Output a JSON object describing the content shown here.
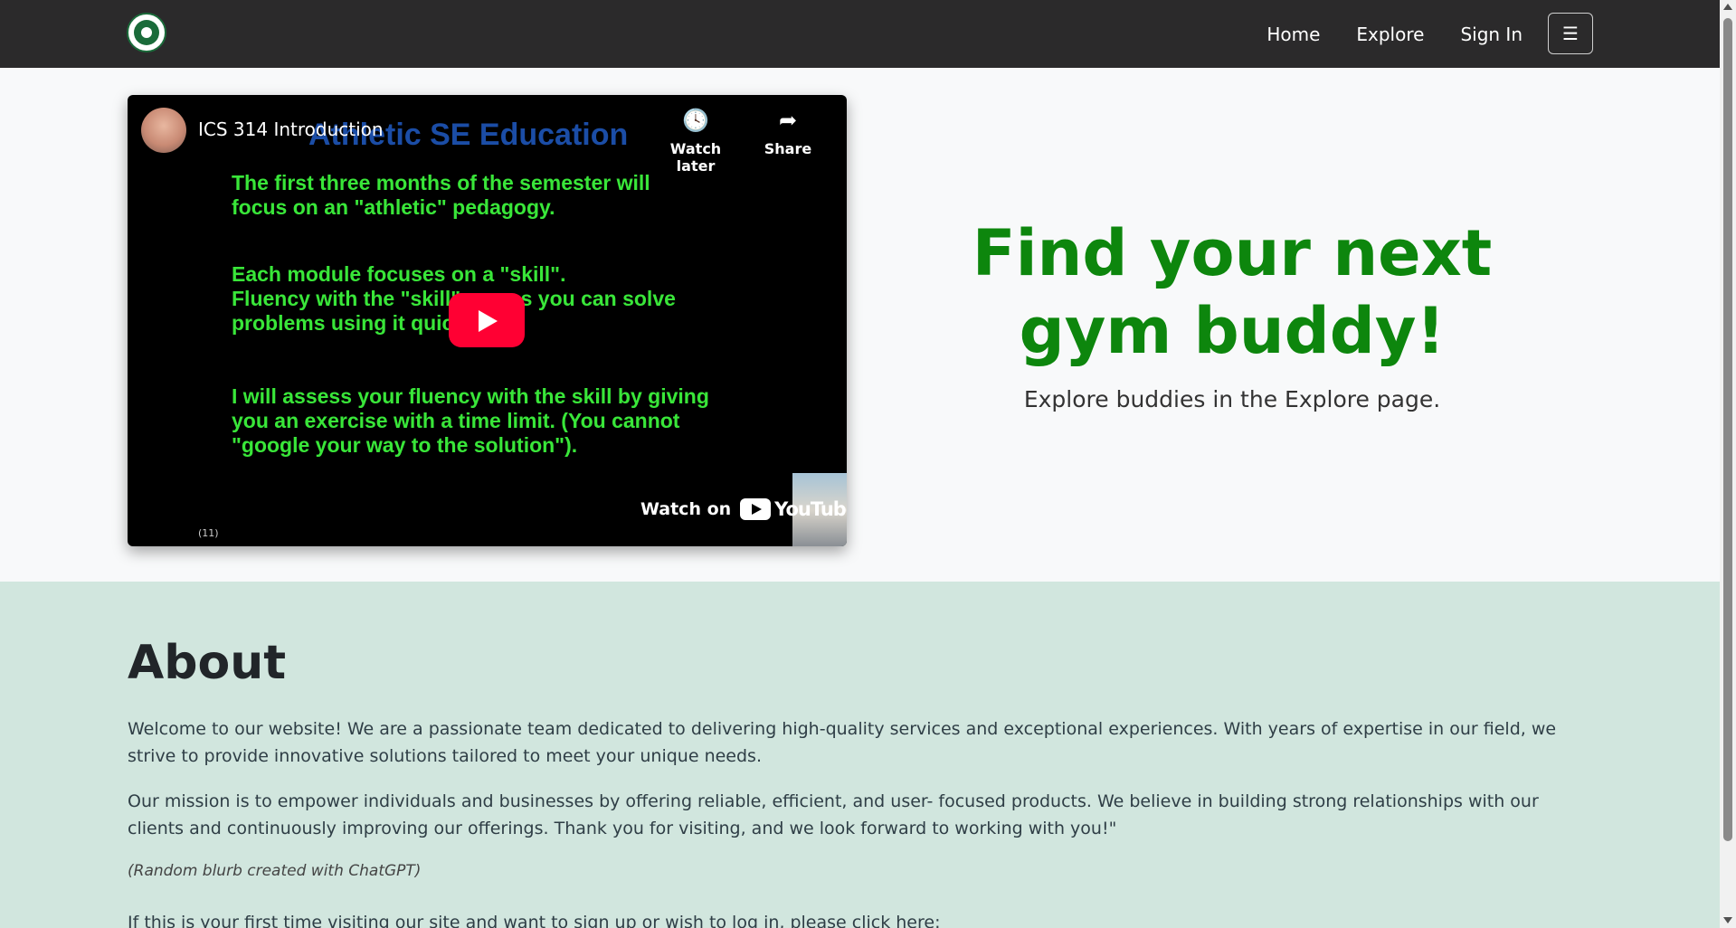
{
  "navbar": {
    "links": [
      "Home",
      "Explore",
      "Sign In"
    ],
    "menu_icon": "☰"
  },
  "video": {
    "title": "ICS 314 Introduction",
    "slide_heading": "Athletic SE Education",
    "slide_paragraphs": [
      "The first three months of the semester will\nfocus on an \"athletic\" pedagogy.",
      "Each module focuses on a \"skill\".\nFluency with the \"skill\" means you can solve\nproblems using it quickly.",
      "I will assess your fluency with the skill by giving\nyou an exercise with a time limit.  (You cannot\n\"google your way to the solution\")."
    ],
    "watch_later_label": "Watch later",
    "share_label": "Share",
    "watch_on_label": "Watch on",
    "youtube_label": "YouTube",
    "slide_counter": "(11)"
  },
  "hero": {
    "heading": "Find your next gym buddy!",
    "subheading": "Explore buddies in the Explore page."
  },
  "about": {
    "title": "About",
    "paragraph1": "Welcome to our website! We are a passionate team dedicated to delivering high-quality services and exceptional experiences. With years of expertise in our field, we strive to provide innovative solutions tailored to meet your unique needs.",
    "paragraph2": "Our mission is to empower individuals and businesses by offering reliable, efficient, and user- focused products. We believe in building strong relationships with our clients and continuously improving our offerings. Thank you for visiting, and we look forward to working with you!\"",
    "note": "(Random blurb created with ChatGPT)",
    "cta": "If this is your first time visiting our site and want to sign up or wish to log in, please click here:"
  },
  "colors": {
    "navbar_bg": "#2b2a2b",
    "hero_heading": "#0d860d",
    "about_bg": "#d1e6de",
    "play_button": "#ff0033"
  }
}
